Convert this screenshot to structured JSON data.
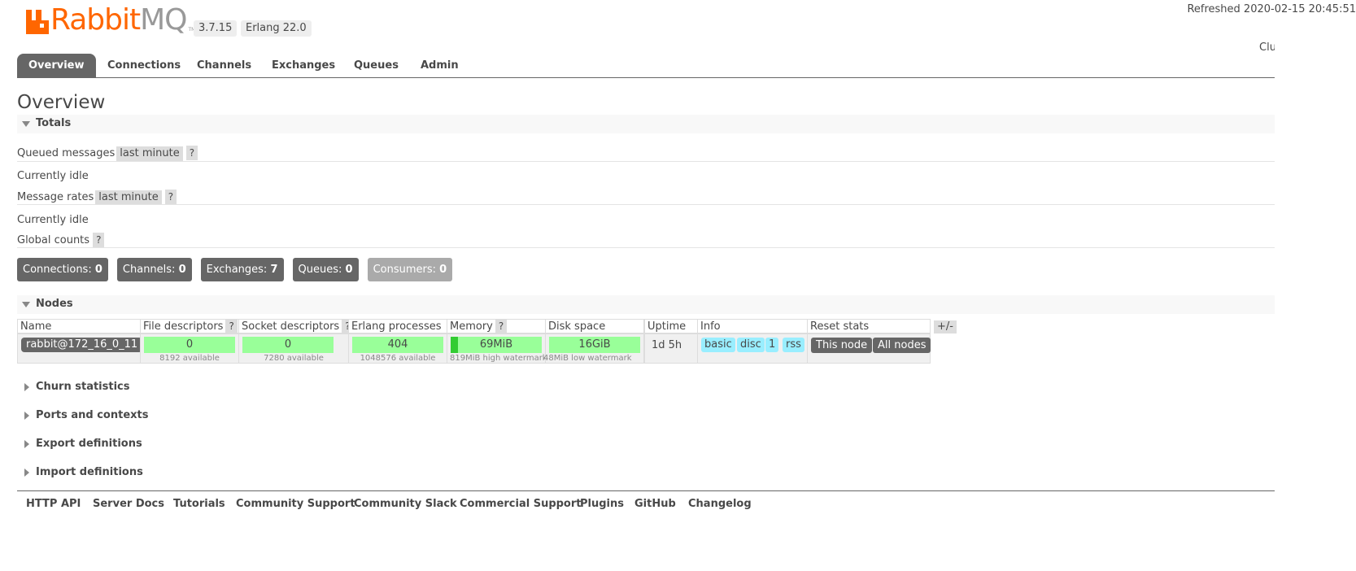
{
  "header": {
    "logo_text_orange": "Rabbit",
    "logo_text_grey": "MQ",
    "logo_tm": "TM",
    "version": "3.7.15",
    "erlang": "Erlang 22.0",
    "refreshed": "Refreshed 2020-02-15 20:45:51",
    "cluster_label": "Clu"
  },
  "tabs": [
    "Overview",
    "Connections",
    "Channels",
    "Exchanges",
    "Queues",
    "Admin"
  ],
  "page_title": "Overview",
  "totals": {
    "heading": "Totals",
    "queued_label": "Queued messages",
    "queued_range": "last minute",
    "queued_idle": "Currently idle",
    "rates_label": "Message rates",
    "rates_range": "last minute",
    "rates_idle": "Currently idle",
    "global_label": "Global counts",
    "help": "?",
    "counts": [
      {
        "label": "Connections:",
        "value": "0"
      },
      {
        "label": "Channels:",
        "value": "0"
      },
      {
        "label": "Exchanges:",
        "value": "7"
      },
      {
        "label": "Queues:",
        "value": "0"
      },
      {
        "label": "Consumers:",
        "value": "0"
      }
    ]
  },
  "nodes": {
    "heading": "Nodes",
    "columns": [
      "Name",
      "File descriptors",
      "Socket descriptors",
      "Erlang processes",
      "Memory",
      "Disk space",
      "Uptime",
      "Info",
      "Reset stats"
    ],
    "plus_minus": "+/-",
    "row": {
      "name": "rabbit@172_16_0_11",
      "fd": "0",
      "fd_sub": "8192 available",
      "sd": "0",
      "sd_sub": "7280 available",
      "ep": "404",
      "ep_sub": "1048576 available",
      "mem": "69MiB",
      "mem_sub": "819MiB high watermark",
      "mem_fraction": 0.084,
      "disk": "16GiB",
      "disk_sub": "48MiB low watermark",
      "uptime": "1d 5h",
      "info_tags": [
        "basic",
        "disc",
        "1",
        "rss"
      ],
      "reset_this": "This node",
      "reset_all": "All nodes"
    }
  },
  "collapsed_sections": [
    "Churn statistics",
    "Ports and contexts",
    "Export definitions",
    "Import definitions"
  ],
  "footer_links": [
    "HTTP API",
    "Server Docs",
    "Tutorials",
    "Community Support",
    "Community Slack",
    "Commercial Support",
    "Plugins",
    "GitHub",
    "Changelog"
  ],
  "colors": {
    "brand_orange": "#ff6600",
    "tab_active": "#666666",
    "bar_green": "#99ff99",
    "tag_blue": "#99eeff"
  }
}
